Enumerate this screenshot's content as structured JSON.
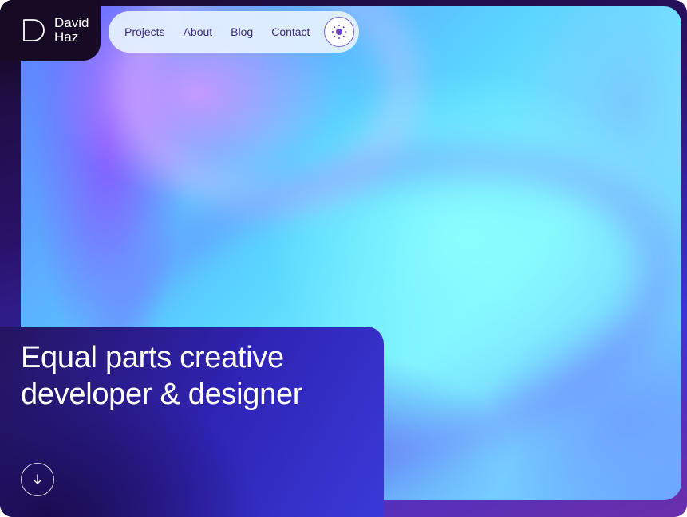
{
  "brand": {
    "name_line1": "David",
    "name_line2": "Haz"
  },
  "nav": {
    "items": [
      {
        "label": "Projects"
      },
      {
        "label": "About"
      },
      {
        "label": "Blog"
      },
      {
        "label": "Contact"
      }
    ],
    "theme_toggle_icon": "sun-icon"
  },
  "hero": {
    "headline_line1": "Equal parts creative",
    "headline_line2": "developer & designer",
    "scroll_icon": "arrow-down-icon"
  },
  "colors": {
    "nav_text": "#3b2a7a",
    "accent": "#7a5cc8",
    "dark_bg": "#160a24"
  }
}
